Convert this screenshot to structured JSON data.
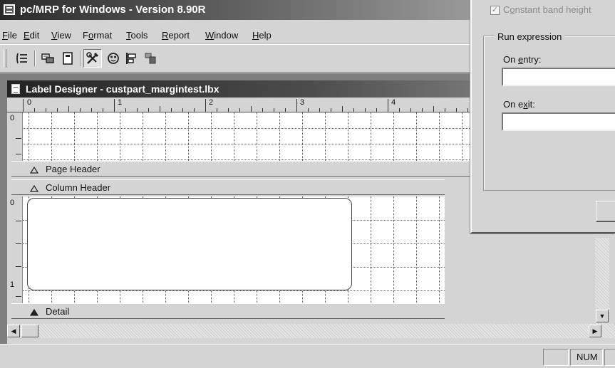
{
  "window": {
    "title": "pc/MRP for Windows - Version 8.90R"
  },
  "menu": [
    {
      "pre": "",
      "key": "F",
      "post": "ile"
    },
    {
      "pre": "",
      "key": "E",
      "post": "dit"
    },
    {
      "pre": "",
      "key": "V",
      "post": "iew"
    },
    {
      "pre": "F",
      "key": "o",
      "post": "rmat"
    },
    {
      "pre": "",
      "key": "T",
      "post": "ools"
    },
    {
      "pre": "",
      "key": "R",
      "post": "eport"
    },
    {
      "pre": "",
      "key": "W",
      "post": "indow"
    },
    {
      "pre": "",
      "key": "H",
      "post": "elp"
    }
  ],
  "toolbar": {
    "buttons": [
      "field-list-icon",
      "data-environment-icon",
      "page-icon",
      "tools-icon",
      "color-palette-icon",
      "align-icon",
      "layout-icon"
    ],
    "pressed": "tools-icon"
  },
  "designer": {
    "title": "Label Designer - custpart_margintest.lbx",
    "ruler_h": [
      "0",
      "1",
      "2",
      "3",
      "4"
    ],
    "ruler_v_top": [
      "0"
    ],
    "ruler_v_detail": [
      "0",
      "1"
    ],
    "bands": {
      "page_header": "Page Header",
      "column_header": "Column Header",
      "detail": "Detail"
    }
  },
  "dialog": {
    "constant_band_height": "Constant band height",
    "constant_band_height_checked": true,
    "run_expression": "Run expression",
    "on_entry_pre": "On ",
    "on_entry_key": "e",
    "on_entry_post": "ntry:",
    "on_exit_pre": "On e",
    "on_exit_key": "x",
    "on_exit_post": "it:",
    "on_entry_value": "",
    "on_exit_value": ""
  },
  "status": {
    "num": "NUM"
  }
}
